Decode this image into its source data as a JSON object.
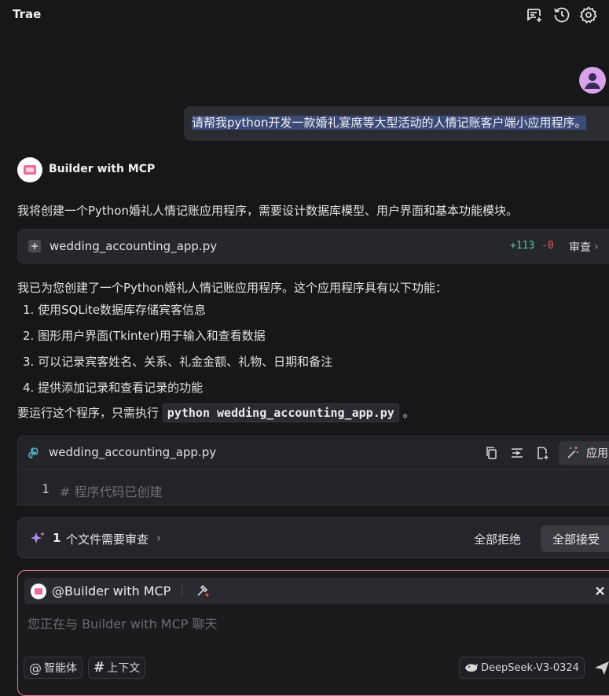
{
  "app": {
    "title": "Trae"
  },
  "header": {
    "icons": [
      "new-chat-icon",
      "history-icon",
      "settings-icon"
    ]
  },
  "user_message": {
    "text": "请帮我python开发一款婚礼宴席等大型活动的人情记账客户端小应用程序。"
  },
  "bot": {
    "name": "Builder with MCP",
    "intro": "我将创建一个Python婚礼人情记账应用程序，需要设计数据库模型、用户界面和基本功能模块。",
    "file_card": {
      "filename": "wedding_accounting_app.py",
      "added": "+113",
      "removed": "-0",
      "review_label": "审查"
    },
    "summary": "我已为您创建了一个Python婚礼人情记账应用程序。这个应用程序具有以下功能：",
    "features": [
      "1. 使用SQLite数据库存储宾客信息",
      "2. 图形用户界面(Tkinter)用于输入和查看数据",
      "3. 可以记录宾客姓名、关系、礼金金额、礼物、日期和备注",
      "4. 提供添加记录和查看记录的功能"
    ],
    "run_prefix": "要运行这个程序，只需执行",
    "run_command": "python wedding_accounting_app.py",
    "run_suffix": "。",
    "code_block": {
      "filename": "wedding_accounting_app.py",
      "apply_label": "应用",
      "line_number": "1",
      "code_line": "#  程序代码已创建"
    }
  },
  "review_bar": {
    "count": "1",
    "text": "个文件需要审查",
    "reject_all": "全部拒绝",
    "accept_all": "全部接受"
  },
  "input": {
    "mention": "@Builder with MCP",
    "placeholder": "您正在与 Builder with MCP 聊天",
    "agent_chip": "智能体",
    "context_chip": "上下文",
    "model": "DeepSeek-V3-0324"
  },
  "colors": {
    "background": "#17171a",
    "added": "#4ec9a0",
    "removed": "#e0605a",
    "input_border": "#e57a8e",
    "avatar": "#d9a3ea"
  }
}
